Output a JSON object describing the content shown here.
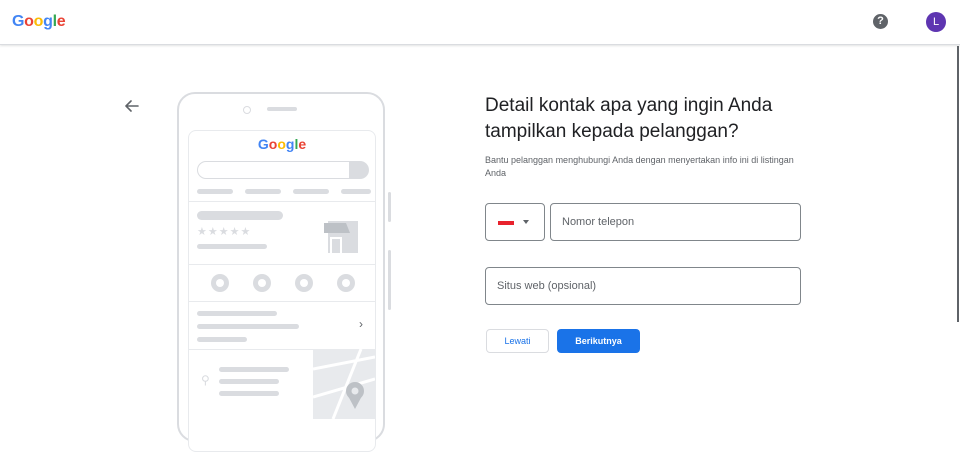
{
  "header": {
    "logo": [
      "G",
      "o",
      "o",
      "g",
      "l",
      "e"
    ],
    "help_symbol": "?",
    "avatar_initial": "L"
  },
  "illustration": {
    "logo": [
      "G",
      "o",
      "o",
      "g",
      "l",
      "e"
    ],
    "stars": "★★★★★",
    "chevron": "›"
  },
  "form": {
    "title": "Detail kontak apa yang ingin Anda tampilkan kepada pelanggan?",
    "subtitle": "Bantu pelanggan menghubungi Anda dengan menyertakan info ini di listingan Anda",
    "phone_placeholder": "Nomor telepon",
    "website_placeholder": "Situs web (opsional)",
    "skip_label": "Lewati",
    "next_label": "Berikutnya"
  },
  "colors": {
    "primary": "#1a73e8",
    "avatar": "#5e35b1",
    "flag_red": "#e8222d"
  },
  "icons": [
    "back-arrow-icon",
    "help-icon",
    "indonesia-flag-icon",
    "dropdown-caret-icon"
  ]
}
